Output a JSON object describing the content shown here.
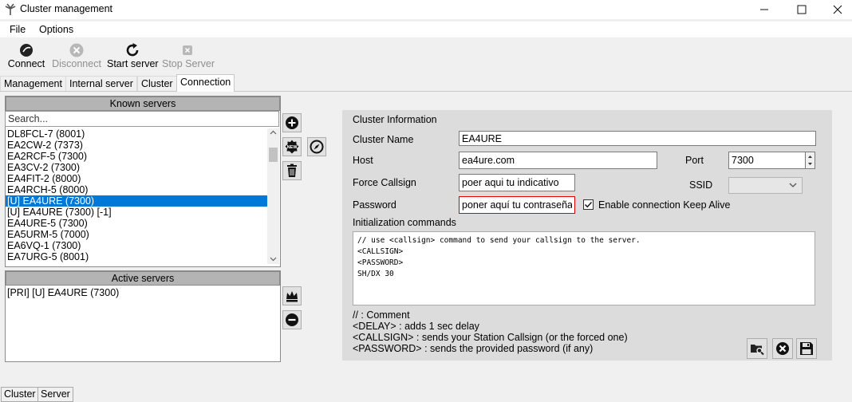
{
  "window": {
    "title": "Cluster management"
  },
  "menu": {
    "file": "File",
    "options": "Options"
  },
  "toolbar": {
    "connect": "Connect",
    "disconnect": "Disconnect",
    "start_server": "Start server",
    "stop_server": "Stop Server"
  },
  "tabs": {
    "management": "Management",
    "internal_server": "Internal server",
    "cluster": "Cluster",
    "connection": "Connection"
  },
  "known_servers": {
    "header": "Known servers",
    "search_placeholder": "Search...",
    "items": [
      "DL8FCL-7 (8001)",
      "EA2CW-2 (7373)",
      "EA2RCF-5 (7300)",
      "EA3CV-2 (7300)",
      "EA4FIT-2 (8000)",
      "EA4RCH-5 (8000)",
      "[U] EA4URE (7300)",
      "[U] EA4URE (7300) [-1]",
      "EA4URE-5 (7300)",
      "EA5URM-5 (7000)",
      "EA6VQ-1 (7300)",
      "EA7URG-5 (8001)"
    ],
    "selected_index": 6
  },
  "active_servers": {
    "header": "Active servers",
    "items": [
      "[PRI] [U] EA4URE (7300)"
    ]
  },
  "cluster_info": {
    "title": "Cluster Information",
    "name_label": "Cluster Name",
    "name_value": "EA4URE",
    "host_label": "Host",
    "host_value": "ea4ure.com",
    "port_label": "Port",
    "port_value": "7300",
    "callsign_label": "Force Callsign",
    "callsign_value": "poer aqui tu indicativo",
    "ssid_label": "SSID",
    "ssid_value": "",
    "password_label": "Password",
    "password_value": "poner aquí tu contraseña",
    "keepalive_label": "Enable connection Keep Alive",
    "init_label": "Initialization commands",
    "init_text": "// use <callsign> command to send your callsign to the server.\n<CALLSIGN>\n<PASSWORD>\nSH/DX 30",
    "help": [
      "// : Comment",
      "<DELAY> : adds 1 sec delay",
      "<CALLSIGN> : sends your Station Callsign (or the forced one)",
      "<PASSWORD> : sends the provided password (if any)"
    ]
  },
  "bottom_tabs": {
    "cluster": "Cluster",
    "server": "Server"
  },
  "colors": {
    "selection": "#0078d7",
    "group_header": "#b4b4b4",
    "info_panel": "#dcdcdc",
    "password_border": "#e00000"
  }
}
